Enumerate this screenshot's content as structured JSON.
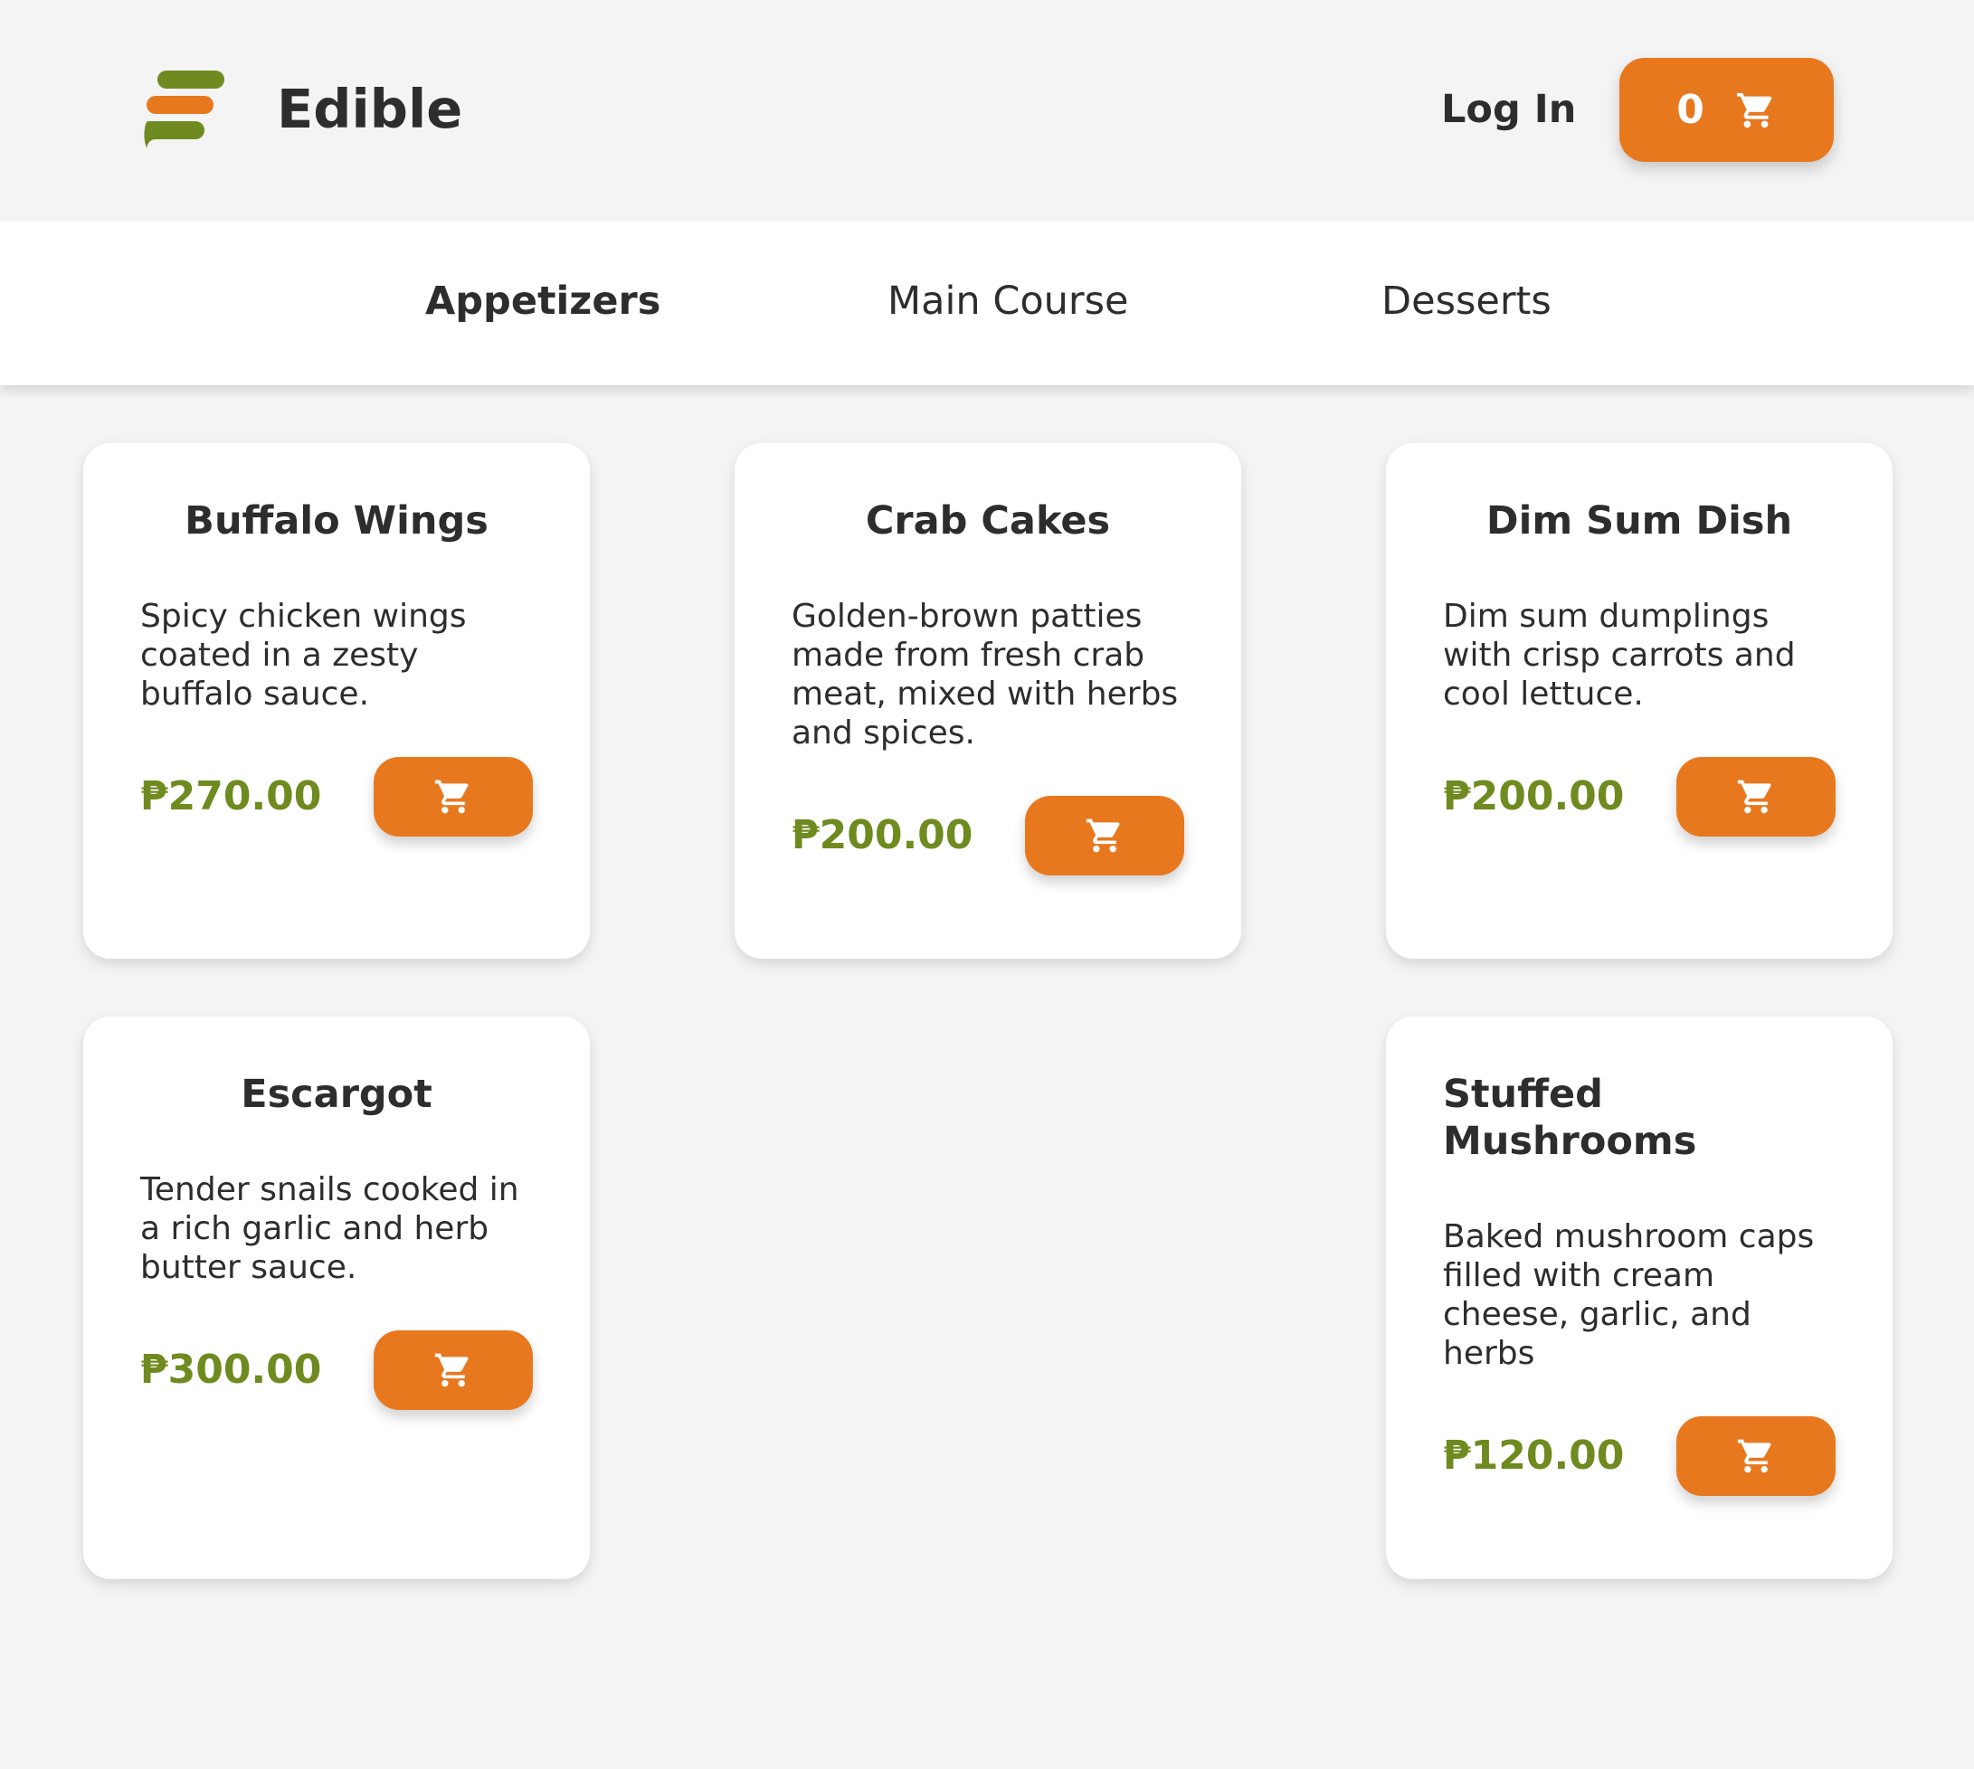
{
  "header": {
    "brand": "Edible",
    "login_label": "Log In",
    "cart_count": "0"
  },
  "colors": {
    "accent_orange": "#e8781e",
    "brand_green": "#6f8a1f",
    "text_dark": "#2d2d2d",
    "page_bg": "#f4f4f4"
  },
  "nav": {
    "tabs": [
      {
        "label": "Appetizers",
        "active": true
      },
      {
        "label": "Main Course",
        "active": false
      },
      {
        "label": "Desserts",
        "active": false
      }
    ]
  },
  "products": [
    {
      "name": "Buffalo Wings",
      "description": "Spicy chicken wings coated in a zesty buffalo sauce.",
      "price": "₱270.00"
    },
    {
      "name": "Crab Cakes",
      "description": "Golden-brown patties made from fresh crab meat, mixed with herbs and spices.",
      "price": "₱200.00"
    },
    {
      "name": "Dim Sum Dish",
      "description": "Dim sum dumplings with crisp carrots and cool lettuce.",
      "price": "₱200.00"
    },
    {
      "name": "Escargot",
      "description": "Tender snails cooked in a rich garlic and herb butter sauce.",
      "price": "₱300.00"
    },
    {
      "name": "Stuffed Mushrooms",
      "description": "Baked mushroom caps filled with cream cheese, garlic, and herbs",
      "price": "₱120.00"
    }
  ],
  "icons": {
    "logo": "edible-logo-icon",
    "cart": "cart-icon"
  }
}
